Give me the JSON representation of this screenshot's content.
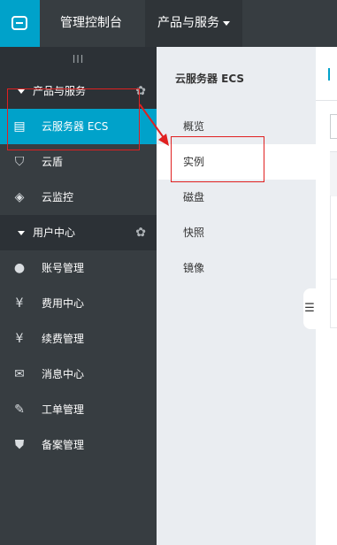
{
  "topbar": {
    "logo_icon": "aliyun-logo-icon",
    "console_label": "管理控制台",
    "products_label": "产品与服务"
  },
  "sidebar": {
    "collapse_glyph": "III",
    "groups": [
      {
        "label": "产品与服务",
        "items": [
          {
            "label": "云服务器 ECS",
            "icon": "server-list-icon",
            "active": true
          },
          {
            "label": "云盾",
            "icon": "shield-icon",
            "active": false
          },
          {
            "label": "云监控",
            "icon": "monitor-icon",
            "active": false
          }
        ]
      },
      {
        "label": "用户中心",
        "items": [
          {
            "label": "账号管理",
            "icon": "user-icon"
          },
          {
            "label": "费用中心",
            "icon": "yen-icon"
          },
          {
            "label": "续费管理",
            "icon": "money-bag-icon"
          },
          {
            "label": "消息中心",
            "icon": "envelope-icon"
          },
          {
            "label": "工单管理",
            "icon": "pencil-icon"
          },
          {
            "label": "备案管理",
            "icon": "badge-icon"
          }
        ]
      }
    ]
  },
  "subpanel": {
    "title": "云服务器 ECS",
    "items": [
      {
        "label": "概览"
      },
      {
        "label": "实例",
        "selected": true
      },
      {
        "label": "磁盘"
      },
      {
        "label": "快照"
      },
      {
        "label": "镜像"
      }
    ],
    "handle_glyph": "☰"
  },
  "colors": {
    "topbar": "#373d41",
    "accent": "#00a2ca",
    "sidebar": "#373d41",
    "subpanel": "#eaedf1",
    "annotation": "#e02020"
  }
}
